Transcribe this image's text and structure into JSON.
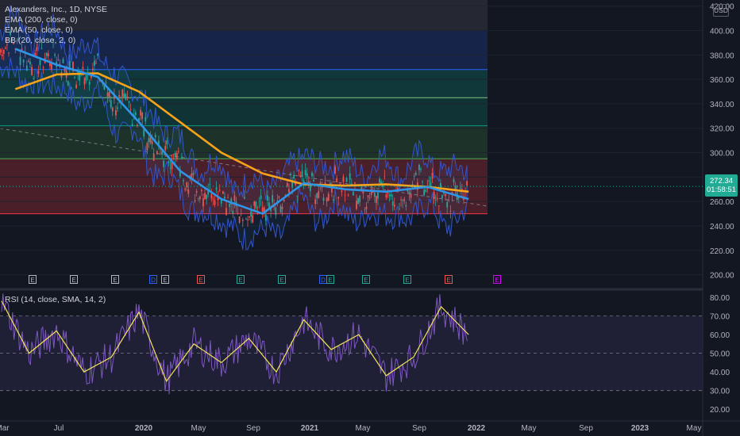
{
  "legend": {
    "title": "Alexanders, Inc., 1D, NYSE",
    "ema200": "EMA (200, close, 0)",
    "ema50": "EMA (50, close, 0)",
    "bb": "BB (20, close, 2, 0)",
    "rsi": "RSI (14, close, SMA, 14, 2)"
  },
  "price_badge": {
    "value": "272.34",
    "countdown": "01:58:51"
  },
  "currency": "USD",
  "price_axis_labels": [
    "420.00",
    "400.00",
    "380.00",
    "360.00",
    "340.00",
    "320.00",
    "300.00",
    "280.00",
    "260.00",
    "240.00",
    "220.00",
    "200.00"
  ],
  "rsi_axis_labels": [
    "80.00",
    "70.00",
    "60.00",
    "50.00",
    "40.00",
    "30.00",
    "20.00"
  ],
  "time_axis_labels": [
    "Mar",
    "Jul",
    "2020",
    "May",
    "Sep",
    "2021",
    "May",
    "Sep",
    "2022",
    "May",
    "Sep",
    "2023",
    "May"
  ],
  "events": [
    "E",
    "E",
    "E",
    "D",
    "E",
    "E",
    "E",
    "E",
    "D",
    "E",
    "E",
    "E",
    "E",
    "E"
  ],
  "colors": {
    "background": "#131722",
    "ema200": "#f7a21b",
    "ema50": "#2e95e8",
    "bollinger": "#3355cc",
    "rsi": "#7e57c2",
    "rsi_ma": "#f5e45b",
    "up": "#26a69a",
    "down": "#ef5350",
    "badge": "#22ab94"
  },
  "chart_data": {
    "type": "line",
    "title": "Alexanders, Inc., 1D, NYSE",
    "x_range": [
      "2019-03",
      "2023-05"
    ],
    "price_ylim": [
      190,
      425
    ],
    "fib_levels": [
      250,
      295,
      322,
      345,
      368,
      400
    ],
    "last_price": 272.34,
    "series": [
      {
        "name": "EMA (200, close, 0)",
        "x": [
          "2019-04",
          "2019-07",
          "2019-10",
          "2020-01",
          "2020-04",
          "2020-07",
          "2020-10",
          "2021-01",
          "2021-04",
          "2021-07",
          "2021-10",
          "2022-01"
        ],
        "values": [
          352,
          364,
          365,
          350,
          325,
          300,
          283,
          274,
          273,
          274,
          272,
          268
        ]
      },
      {
        "name": "EMA (50, close, 0)",
        "x": [
          "2019-04",
          "2019-07",
          "2019-10",
          "2020-01",
          "2020-04",
          "2020-07",
          "2020-10",
          "2021-01",
          "2021-04",
          "2021-07",
          "2021-10",
          "2022-01"
        ],
        "values": [
          385,
          372,
          362,
          325,
          285,
          262,
          250,
          275,
          270,
          268,
          272,
          262
        ]
      },
      {
        "name": "RSI (14, close, SMA, 14, 2)",
        "x": [
          "2019-03",
          "2019-05",
          "2019-07",
          "2019-09",
          "2019-11",
          "2020-01",
          "2020-03",
          "2020-05",
          "2020-07",
          "2020-09",
          "2020-11",
          "2021-01",
          "2021-03",
          "2021-05",
          "2021-07",
          "2021-09",
          "2021-11",
          "2022-01"
        ],
        "values": [
          78,
          50,
          62,
          40,
          48,
          72,
          35,
          55,
          45,
          58,
          40,
          68,
          52,
          60,
          38,
          48,
          75,
          60
        ]
      }
    ],
    "rsi_ylim": [
      15,
      83
    ],
    "rsi_bands": [
      30,
      70
    ]
  }
}
